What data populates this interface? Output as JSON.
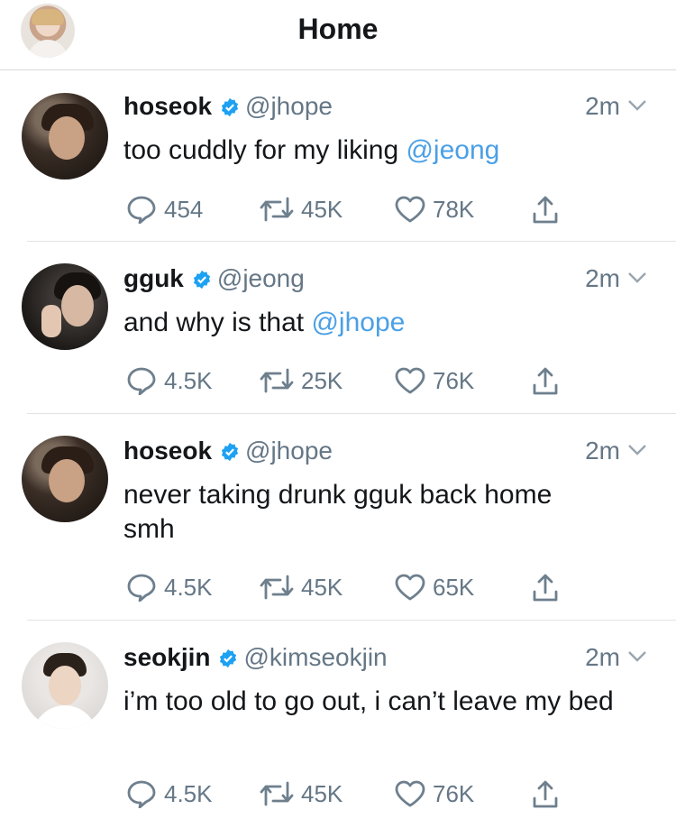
{
  "header": {
    "title": "Home"
  },
  "tweets": [
    {
      "name": "hoseok",
      "handle": "@jhope",
      "time": "2m",
      "text": "too cuddly for my liking ",
      "mention": "@jeong",
      "replies": "454",
      "retweets": "45K",
      "likes": "78K"
    },
    {
      "name": "gguk",
      "handle": "@jeong",
      "time": "2m",
      "text": "and why is that ",
      "mention": "@jhope",
      "replies": "4.5K",
      "retweets": "25K",
      "likes": "76K"
    },
    {
      "name": "hoseok",
      "handle": "@jhope",
      "time": "2m",
      "text": "never taking drunk gguk back home smh",
      "mention": "",
      "replies": "4.5K",
      "retweets": "45K",
      "likes": "65K"
    },
    {
      "name": "seokjin",
      "handle": "@kimseokjin",
      "time": "2m",
      "text": "i’m too old to go out, i can’t leave my bed",
      "mention": "",
      "replies": "4.5K",
      "retweets": "45K",
      "likes": "76K"
    }
  ],
  "colors": {
    "accent": "#4ba0e6",
    "muted": "#657786",
    "text": "#14171a"
  }
}
